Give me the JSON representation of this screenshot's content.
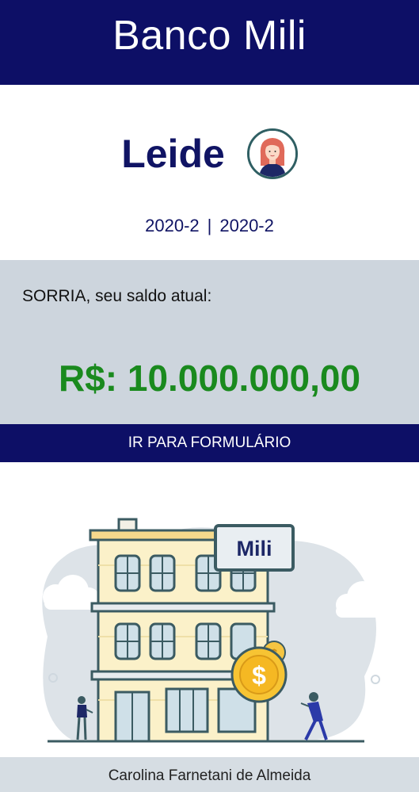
{
  "app": {
    "title": "Banco Mili"
  },
  "user": {
    "name": "Leide",
    "avatar_icon": "woman-avatar-icon",
    "period_start": "2020-2",
    "period_separator": "|",
    "period_end": "2020-2"
  },
  "balance": {
    "label": "SORRIA, seu saldo atual:",
    "value": "R$: 10.000.000,00",
    "value_color": "#1a8a1e"
  },
  "actions": {
    "form_button_label": "IR PARA FORMULÁRIO"
  },
  "illustration": {
    "sign_text": "Mili",
    "coin_symbol": "$",
    "icon": "bank-building-illustration"
  },
  "footer": {
    "text": "Carolina Farnetani de Almeida"
  },
  "colors": {
    "primary": "#0d0f66",
    "balance_bg": "#cdd5dd",
    "footer_bg": "#d6dde3"
  }
}
